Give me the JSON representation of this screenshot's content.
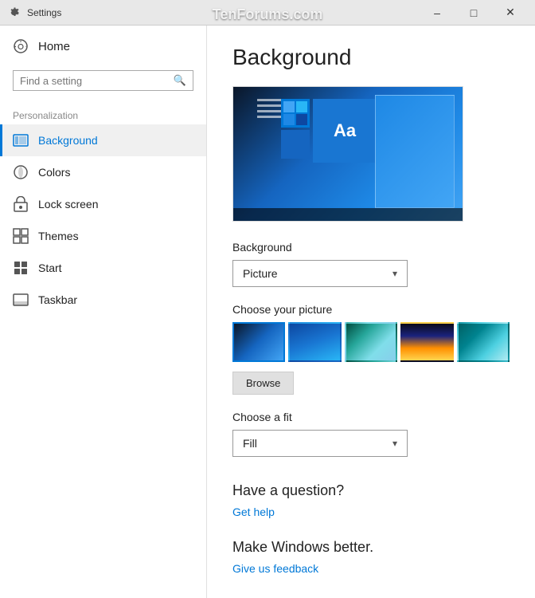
{
  "titleBar": {
    "title": "Settings",
    "minimizeLabel": "–",
    "maximizeLabel": "□",
    "closeLabel": "✕"
  },
  "watermark": "TenForums.com",
  "sidebar": {
    "homeLabel": "Home",
    "searchPlaceholder": "Find a setting",
    "sectionLabel": "Personalization",
    "navItems": [
      {
        "id": "background",
        "label": "Background",
        "icon": "background",
        "active": true
      },
      {
        "id": "colors",
        "label": "Colors",
        "icon": "colors",
        "active": false
      },
      {
        "id": "lock-screen",
        "label": "Lock screen",
        "icon": "lock",
        "active": false
      },
      {
        "id": "themes",
        "label": "Themes",
        "icon": "themes",
        "active": false
      },
      {
        "id": "start",
        "label": "Start",
        "icon": "start",
        "active": false
      },
      {
        "id": "taskbar",
        "label": "Taskbar",
        "icon": "taskbar",
        "active": false
      }
    ]
  },
  "main": {
    "pageTitle": "Background",
    "backgroundLabel": "Background",
    "backgroundDropdown": "Picture",
    "choosePictureLabel": "Choose your picture",
    "browseButtonLabel": "Browse",
    "chooseAFitLabel": "Choose a fit",
    "fitDropdown": "Fill",
    "haveAQuestion": "Have a question?",
    "getHelpLink": "Get help",
    "makeWindowsBetter": "Make Windows better.",
    "giveFeedbackLink": "Give us feedback"
  }
}
